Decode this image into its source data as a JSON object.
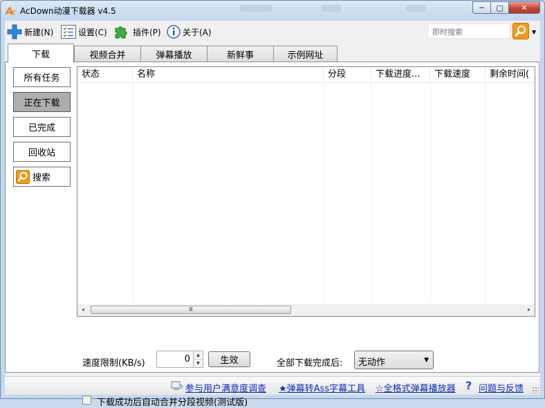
{
  "window": {
    "title": "AcDown动漫下载器 v4.5",
    "controls": {
      "minimize": "─",
      "maximize": "▢",
      "close": "✕"
    }
  },
  "menu": [
    {
      "label": "新建(N)",
      "icon": "plus-icon"
    },
    {
      "label": "设置(C)",
      "icon": "settings-list-icon"
    },
    {
      "label": "插件(P)",
      "icon": "puzzle-icon"
    },
    {
      "label": "关于(A)",
      "icon": "info-icon"
    }
  ],
  "search": {
    "placeholder": "即时搜索",
    "icon": "magnifier-icon"
  },
  "tabs": [
    "下载",
    "视频合并",
    "弹幕播放",
    "新鲜事",
    "示例网址"
  ],
  "active_tab": "下载",
  "sidebar": [
    {
      "label": "所有任务",
      "selected": false
    },
    {
      "label": "正在下载",
      "selected": true
    },
    {
      "label": "已完成",
      "selected": false
    },
    {
      "label": "回收站",
      "selected": false
    },
    {
      "label": "搜索",
      "icon": "magnifier-icon",
      "selected": false
    }
  ],
  "table": {
    "columns": [
      "状态",
      "名称",
      "分段",
      "下载进度...",
      "下载速度",
      "剩余时间("
    ],
    "rows": []
  },
  "scroll": {
    "left": "◂",
    "right": "▸",
    "thumb": "Ⅲ"
  },
  "controls": {
    "speed_label": "速度限制(KB/s)",
    "speed_value": "0",
    "apply_label": "生效",
    "after_label": "全部下载完成后:",
    "after_value": "无动作",
    "auto_merge_label": "下载成功后自动合并分段视频(测试版)",
    "auto_merge_checked": false
  },
  "status_links": [
    "参与用户满意度调查",
    "★弹幕转Ass字幕工具",
    "☆全格式弹幕播放器",
    "问题与反馈"
  ],
  "colors": {
    "accent_orange": "#f39a1b",
    "link_blue": "#0b2bb5",
    "title_bg": "#c5d7ee"
  }
}
